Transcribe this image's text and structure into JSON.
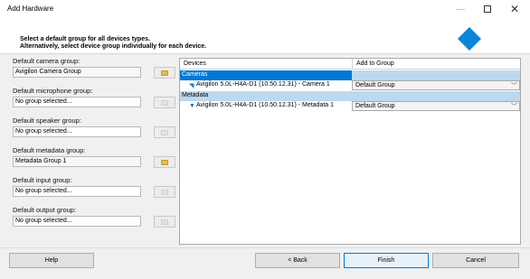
{
  "window": {
    "title": "Add Hardware"
  },
  "header": {
    "line1": "Select a default group for all devices types.",
    "line2": "Alternatively, select device group individually for each device.",
    "logo_color": "#0a85d9"
  },
  "defaults": [
    {
      "label": "Default camera group:",
      "value": "Avigilon Camera Group",
      "filled": true,
      "browse_enabled": true
    },
    {
      "label": "Default microphone group:",
      "value": "No group selected...",
      "filled": false,
      "browse_enabled": false
    },
    {
      "label": "Default speaker group:",
      "value": "No group selected...",
      "filled": false,
      "browse_enabled": false
    },
    {
      "label": "Default metadata group:",
      "value": "Metadata Group 1",
      "filled": true,
      "browse_enabled": true
    },
    {
      "label": "Default input group:",
      "value": "No group selected...",
      "filled": false,
      "browse_enabled": false
    },
    {
      "label": "Default output group:",
      "value": "No group selected...",
      "filled": false,
      "browse_enabled": false
    }
  ],
  "grid": {
    "col_devices": "Devices",
    "col_group": "Add to Group",
    "sections": [
      {
        "name": "Cameras",
        "selected": true,
        "devices": [
          {
            "name": "Avigilon 5.0L-H4A-D1 (10.50.12.31) - Camera 1",
            "group": "Default Group",
            "icon": "camera-icon"
          }
        ]
      },
      {
        "name": "Metadata",
        "selected": false,
        "devices": [
          {
            "name": "Avigilon 5.0L-H4A-D1 (10.50.12.31) - Metadata 1",
            "group": "Default Group",
            "icon": "metadata-icon"
          }
        ]
      }
    ]
  },
  "footer": {
    "help": "Help",
    "back": "< Back",
    "finish": "Finish",
    "cancel": "Cancel"
  }
}
